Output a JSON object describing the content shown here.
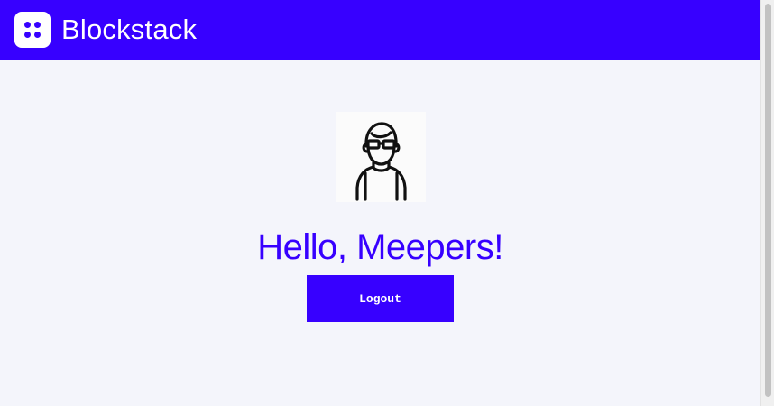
{
  "header": {
    "brand": "Blockstack",
    "logo_icon": "blockstack-logo-icon"
  },
  "profile": {
    "avatar_icon": "user-avatar-icon",
    "greeting": "Hello, Meepers!"
  },
  "actions": {
    "logout_label": "Logout"
  },
  "colors": {
    "brand": "#3700ff",
    "background": "#f4f5fb"
  }
}
